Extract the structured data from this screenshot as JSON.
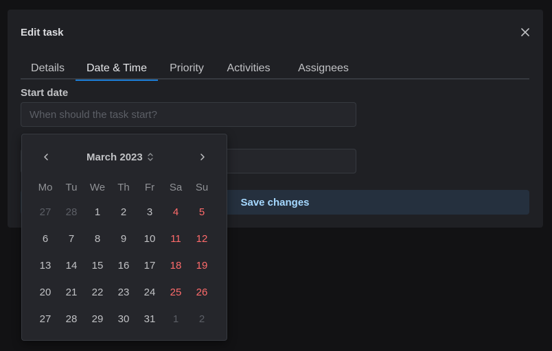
{
  "modal": {
    "title": "Edit task",
    "close_icon": "close-icon"
  },
  "tabs": [
    {
      "label": "Details",
      "active": false
    },
    {
      "label": "Date & Time",
      "active": true
    },
    {
      "label": "Priority",
      "active": false
    },
    {
      "label": "Activities",
      "active": false
    },
    {
      "label": "Assignees",
      "active": false
    }
  ],
  "start_date": {
    "label": "Start date",
    "placeholder": "When should the task start?",
    "value": ""
  },
  "end_date": {
    "value": ""
  },
  "save_button": {
    "label": "Save changes"
  },
  "calendar": {
    "month_label": "March 2023",
    "prev_icon": "chevron-left-icon",
    "next_icon": "chevron-right-icon",
    "month_select_icon": "selector-icon",
    "weekdays": [
      "Mo",
      "Tu",
      "We",
      "Th",
      "Fr",
      "Sa",
      "Su"
    ],
    "weeks": [
      [
        {
          "d": "27",
          "o": true
        },
        {
          "d": "28",
          "o": true
        },
        {
          "d": "1"
        },
        {
          "d": "2"
        },
        {
          "d": "3"
        },
        {
          "d": "4"
        },
        {
          "d": "5"
        }
      ],
      [
        {
          "d": "6"
        },
        {
          "d": "7"
        },
        {
          "d": "8"
        },
        {
          "d": "9"
        },
        {
          "d": "10"
        },
        {
          "d": "11"
        },
        {
          "d": "12"
        }
      ],
      [
        {
          "d": "13"
        },
        {
          "d": "14"
        },
        {
          "d": "15"
        },
        {
          "d": "16"
        },
        {
          "d": "17"
        },
        {
          "d": "18"
        },
        {
          "d": "19"
        }
      ],
      [
        {
          "d": "20"
        },
        {
          "d": "21"
        },
        {
          "d": "22"
        },
        {
          "d": "23"
        },
        {
          "d": "24"
        },
        {
          "d": "25"
        },
        {
          "d": "26"
        }
      ],
      [
        {
          "d": "27"
        },
        {
          "d": "28"
        },
        {
          "d": "29"
        },
        {
          "d": "30"
        },
        {
          "d": "31"
        },
        {
          "d": "1",
          "o": true
        },
        {
          "d": "2",
          "o": true
        }
      ]
    ]
  },
  "colors": {
    "accent": "#1c7ed6",
    "weekend": "#ff6b6b",
    "button_text": "#a5d8ff"
  }
}
